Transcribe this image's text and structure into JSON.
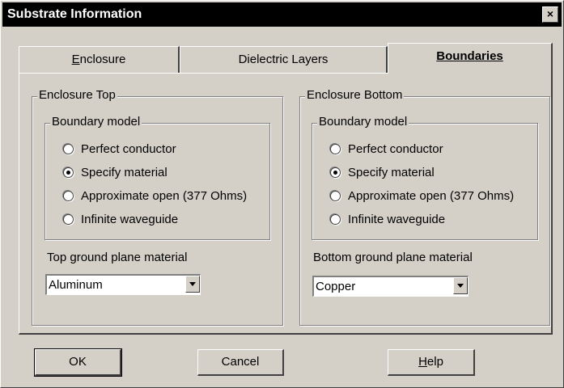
{
  "window": {
    "title": "Substrate Information",
    "close_glyph": "×"
  },
  "tabs": [
    {
      "label": "Enclosure",
      "mnemonic_first": "E",
      "rest": "nclosure"
    },
    {
      "label": "Dielectric Layers"
    },
    {
      "label": "Boundaries"
    }
  ],
  "top": {
    "group_title": "Enclosure Top",
    "boundary_title": "Boundary model",
    "options": [
      "Perfect conductor",
      "Specify material",
      "Approximate open (377 Ohms)",
      "Infinite waveguide"
    ],
    "selected": "Specify material",
    "ground_label": "Top ground plane material",
    "ground_value": "Aluminum"
  },
  "bottom": {
    "group_title": "Enclosure Bottom",
    "boundary_title": "Boundary model",
    "options": [
      "Perfect conductor",
      "Specify material",
      "Approximate open (377 Ohms)",
      "Infinite waveguide"
    ],
    "selected": "Specify material",
    "ground_label": "Bottom ground plane material",
    "ground_value": "Copper"
  },
  "buttons": {
    "ok": "OK",
    "cancel": "Cancel",
    "help_first": "H",
    "help_rest": "elp"
  }
}
